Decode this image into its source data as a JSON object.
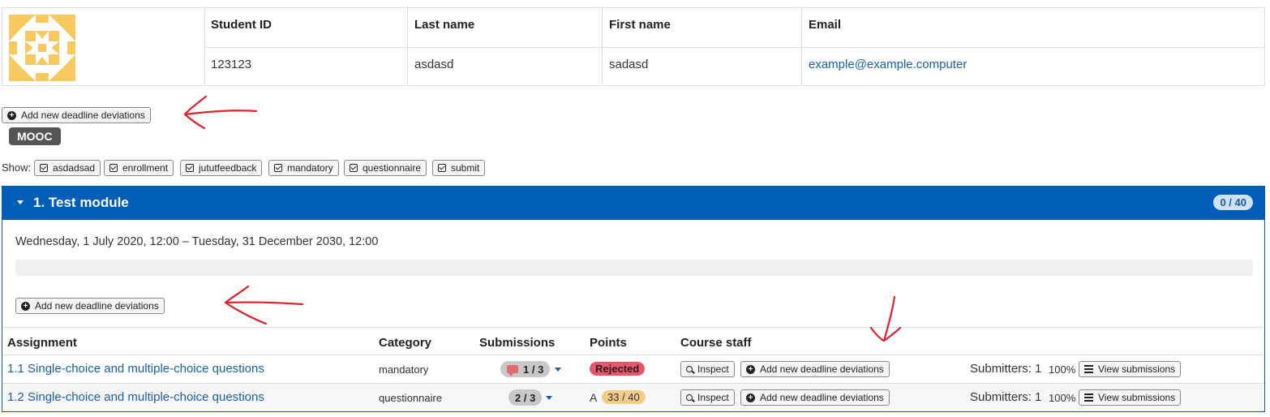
{
  "student": {
    "headers": [
      "Student ID",
      "Last name",
      "First name",
      "Email"
    ],
    "id": "123123",
    "last_name": "asdasd",
    "first_name": "sadasd",
    "email": "example@example.computer"
  },
  "add_deviation_label": "Add new deadline deviations",
  "course_tag": "MOOC",
  "filter": {
    "label": "Show:",
    "tags": [
      "asdadsad",
      "enrollment",
      "jututfeedback",
      "mandatory",
      "questionnaire",
      "submit"
    ]
  },
  "module": {
    "title": "1. Test module",
    "points": "0 / 40",
    "dates": "Wednesday, 1 July 2020, 12:00 – Tuesday, 31 December 2030, 12:00",
    "progress": 0,
    "add_deviation_label": "Add new deadline deviations"
  },
  "table": {
    "headers": {
      "assignment": "Assignment",
      "category": "Category",
      "submissions": "Submissions",
      "points": "Points",
      "staff": "Course staff"
    },
    "rows": [
      {
        "assignment": "1.1 Single-choice and multiple-choice questions",
        "category": "mandatory",
        "submissions": "1 / 3",
        "points_status": "Rejected",
        "inspect": "Inspect",
        "add_deviation": "Add new deadline deviations",
        "submitters": "Submitters: 1",
        "percent": "100%",
        "view": "View submissions"
      },
      {
        "assignment": "1.2 Single-choice and multiple-choice questions",
        "category": "questionnaire",
        "submissions": "2 / 3",
        "grade": "A",
        "points": "33 / 40",
        "inspect": "Inspect",
        "add_deviation": "Add new deadline deviations",
        "submitters": "Submitters: 1",
        "percent": "100%",
        "view": "View submissions"
      }
    ]
  },
  "colors": {
    "module_header": "#005eb8",
    "link": "#1a5fa6",
    "rejected": "#e8566b",
    "points_badge": "#f5cc88",
    "annotation_arrow": "#e0202a"
  }
}
